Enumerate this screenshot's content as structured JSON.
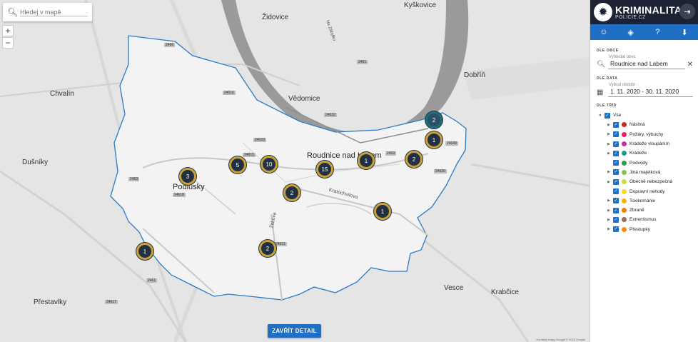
{
  "map": {
    "search_placeholder": "Hledej v mapě",
    "zoom_in": "+",
    "zoom_out": "−",
    "close_detail_label": "ZAVŘÍT DETAIL",
    "attribution": "Kontakty mapy Google © 2020 Google",
    "places": {
      "kyskovice": "Kyškovice",
      "zidovice": "Židovice",
      "chvalin": "Chvalín",
      "vedomice": "Vědomice",
      "dobrin": "Dobříň",
      "dusniky": "Dušníky",
      "roudnice": "Roudnice nad Labem",
      "podlusky": "Podlusky",
      "vesce": "Vesce",
      "krabcice": "Krabčice",
      "prestavlky": "Přestavlky",
      "zitkova": "Žitkova",
      "kratochvilova": "Kratochvilova",
      "na_zabylku": "Na Zábylku"
    },
    "roadnums": [
      "2466",
      "24016",
      "24032",
      "2461",
      "24023",
      "2463",
      "24615",
      "24618",
      "24049",
      "24620",
      "24611",
      "24617",
      "2461",
      "2463"
    ],
    "clusters": [
      {
        "count": "2",
        "teal": true
      },
      {
        "count": "1"
      },
      {
        "count": "2"
      },
      {
        "count": "1"
      },
      {
        "count": "15"
      },
      {
        "count": "10"
      },
      {
        "count": "5"
      },
      {
        "count": "3"
      },
      {
        "count": "2"
      },
      {
        "count": "1"
      },
      {
        "count": "2"
      },
      {
        "count": "1"
      }
    ]
  },
  "panel": {
    "brand_title": "KRIMINALITA",
    "brand_subtitle": "POLICIE.CZ",
    "section_obec": "DLE OBCE",
    "obec_label": "Vyhledat obec",
    "obec_value": "Roudnice nad Labem",
    "section_data": "DLE DATA",
    "data_label": "Vybrat období",
    "data_value": "1. 11. 2020 - 30. 11. 2020",
    "section_trid": "DLE TŘÍD",
    "tree": [
      {
        "label": "Vše",
        "color": "",
        "arrow": "down"
      },
      {
        "label": "Násilná",
        "color": "#c62828",
        "arrow": "right"
      },
      {
        "label": "Požáry, výbuchy",
        "color": "#e91e63",
        "arrow": "right"
      },
      {
        "label": "Krádeže vloupáním",
        "color": "#c531a8",
        "arrow": "right"
      },
      {
        "label": "Krádeže",
        "color": "#1a9c8c",
        "arrow": "right"
      },
      {
        "label": "Podvody",
        "color": "#2e9e48",
        "arrow": ""
      },
      {
        "label": "Jiná majetková",
        "color": "#8bc34a",
        "arrow": "right"
      },
      {
        "label": "Obecně nebezpečná",
        "color": "#cddc39",
        "arrow": "right"
      },
      {
        "label": "Dopravní nehody",
        "color": "#f1dd20",
        "arrow": ""
      },
      {
        "label": "Toxikománie",
        "color": "#f4b400",
        "arrow": "right"
      },
      {
        "label": "Zbraně",
        "color": "#f57c00",
        "arrow": "right"
      },
      {
        "label": "Extremismus",
        "color": "#8d6e63",
        "arrow": "right"
      },
      {
        "label": "Přestupky",
        "color": "#fb8c00",
        "arrow": "right"
      }
    ]
  }
}
